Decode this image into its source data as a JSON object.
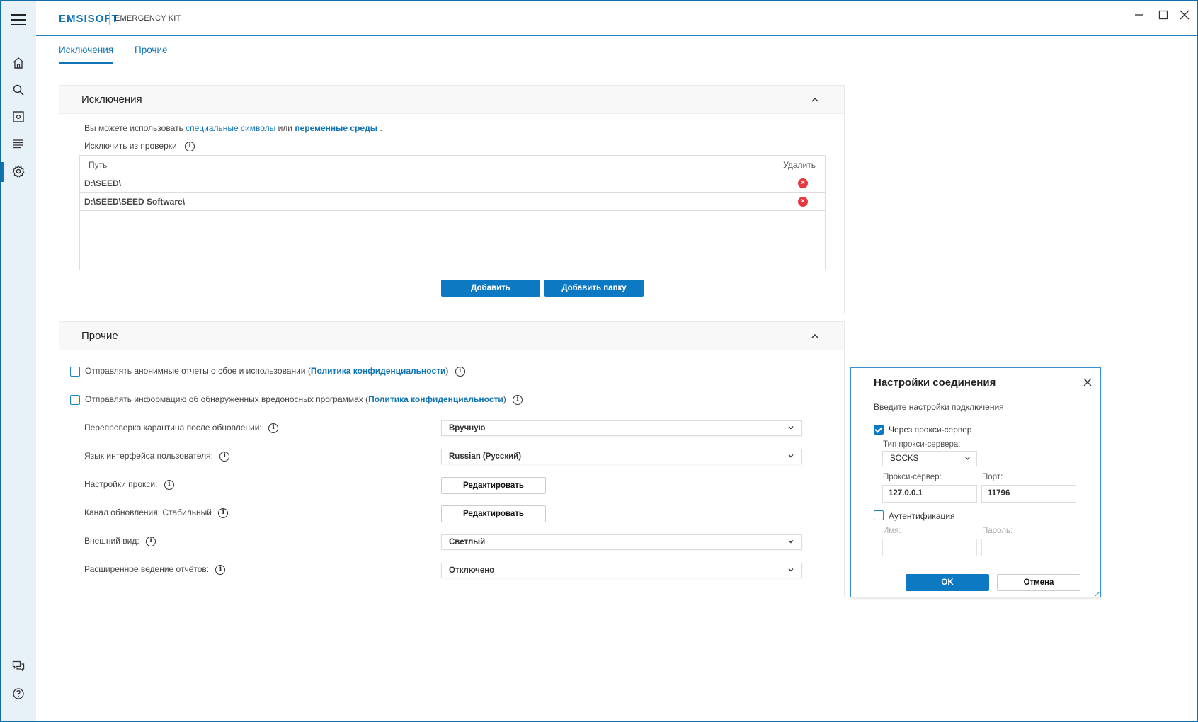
{
  "app": {
    "logo": "EMSISOFT",
    "product": "EMERGENCY KIT"
  },
  "tabs": [
    {
      "label": "Исключения",
      "active": true
    },
    {
      "label": "Прочие",
      "active": false
    }
  ],
  "exclusions": {
    "title": "Исключения",
    "note_prefix": "Вы можете использовать",
    "note_link1": "специальные символы",
    "note_mid": "или",
    "note_link2": "переменные среды",
    "note_suffix": ".",
    "exclude_label": "Исключить из проверки",
    "col_path": "Путь",
    "col_delete": "Удалить",
    "rows": [
      {
        "path": "D:\\SEED\\"
      },
      {
        "path": "D:\\SEED\\SEED Software\\"
      }
    ],
    "add_label": "Добавить",
    "add_folder_label": "Добавить папку"
  },
  "other": {
    "title": "Прочие",
    "checkbox1_text": "Отправлять анонимные отчеты о сбое и использовании (",
    "checkbox1_link": "Политика конфиденциальности",
    "checkbox1_end": ")",
    "checkbox2_text": "Отправлять информацию об обнаруженных вредоносных программах (",
    "checkbox2_link": "Политика конфиденциальности",
    "checkbox2_end": ")",
    "settings": {
      "rescan_label": "Перепроверка карантина после обновлений:",
      "rescan_value": "Вручную",
      "language_label": "Язык интерфейса пользователя:",
      "language_value": "Russian (Русский)",
      "proxy_label": "Настройки прокси:",
      "proxy_button": "Редактировать",
      "channel_label": "Канал обновления: Стабильный",
      "channel_button": "Редактировать",
      "appearance_label": "Внешний вид:",
      "appearance_value": "Светлый",
      "logging_label": "Расширенное ведение отчётов:",
      "logging_value": "Отключено"
    }
  },
  "dialog": {
    "title": "Настройки соединения",
    "subtitle": "Введите настройки подключения",
    "use_proxy_label": "Через прокси-сервер",
    "use_proxy_checked": true,
    "proxy_type_label": "Тип прокси-сервера:",
    "proxy_type_value": "SOCKS",
    "proxy_server_label": "Прокси-сервер:",
    "proxy_server_value": "127.0.0.1",
    "port_label": "Порт:",
    "port_value": "11796",
    "auth_label": "Аутентификация",
    "auth_checked": false,
    "username_label": "Имя:",
    "password_label": "Пароль:",
    "ok_label": "OK",
    "cancel_label": "Отмена"
  },
  "colors": {
    "accent": "#0e79c3",
    "sidebar_bg": "#e7f1f8",
    "delete_red": "#e8383d"
  }
}
